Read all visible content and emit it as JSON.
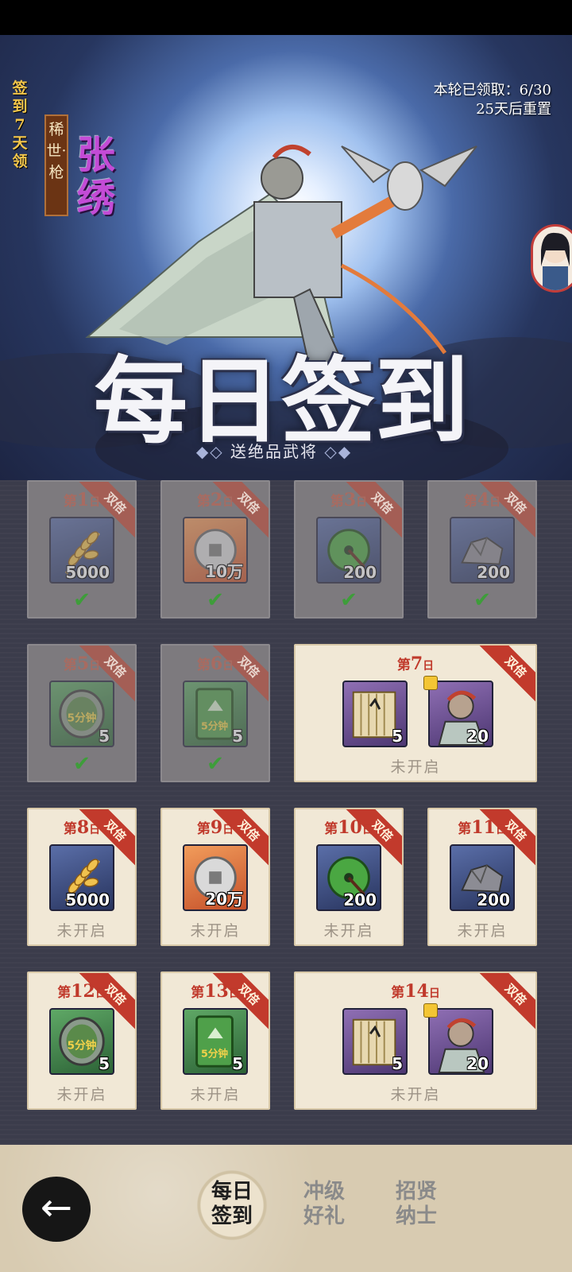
{
  "banner": {
    "side_label": "签到7天领",
    "rarity": "稀世·枪",
    "hero_name": "张绣",
    "progress_line1": "本轮已领取：6/30",
    "progress_line2": "25天后重置",
    "title": "每日签到",
    "subtitle": "送绝品武将"
  },
  "days": [
    {
      "prefix": "第",
      "num": "1",
      "suffix": "日",
      "badge": "双倍",
      "items": [
        {
          "icon": "wheat-icon",
          "qty": "5000"
        }
      ],
      "status": "claimed"
    },
    {
      "prefix": "第",
      "num": "2",
      "suffix": "日",
      "badge": "双倍",
      "items": [
        {
          "icon": "coin-icon",
          "qty": "10万"
        }
      ],
      "status": "claimed"
    },
    {
      "prefix": "第",
      "num": "3",
      "suffix": "日",
      "badge": "双倍",
      "items": [
        {
          "icon": "jade-disc-icon",
          "qty": "200"
        }
      ],
      "status": "claimed"
    },
    {
      "prefix": "第",
      "num": "4",
      "suffix": "日",
      "badge": "双倍",
      "items": [
        {
          "icon": "ore-icon",
          "qty": "200"
        }
      ],
      "status": "claimed"
    },
    {
      "prefix": "第",
      "num": "5",
      "suffix": "日",
      "badge": "双倍",
      "items": [
        {
          "icon": "speedup-token-icon",
          "qty": "5",
          "label": "5分钟"
        }
      ],
      "status": "claimed"
    },
    {
      "prefix": "第",
      "num": "6",
      "suffix": "日",
      "badge": "双倍",
      "items": [
        {
          "icon": "speedup-card-icon",
          "qty": "5",
          "label": "5分钟"
        }
      ],
      "status": "claimed"
    },
    {
      "prefix": "第",
      "num": "7",
      "suffix": "日",
      "badge": "双倍",
      "items": [
        {
          "icon": "scroll-icon",
          "qty": "5"
        },
        {
          "icon": "hero-shard-icon",
          "qty": "20"
        }
      ],
      "status": "未开启"
    },
    {
      "prefix": "第",
      "num": "8",
      "suffix": "日",
      "badge": "双倍",
      "items": [
        {
          "icon": "wheat-icon",
          "qty": "5000"
        }
      ],
      "status": "未开启"
    },
    {
      "prefix": "第",
      "num": "9",
      "suffix": "日",
      "badge": "双倍",
      "items": [
        {
          "icon": "coin-icon",
          "qty": "20万"
        }
      ],
      "status": "未开启"
    },
    {
      "prefix": "第",
      "num": "10",
      "suffix": "日",
      "badge": "双倍",
      "items": [
        {
          "icon": "jade-disc-icon",
          "qty": "200"
        }
      ],
      "status": "未开启"
    },
    {
      "prefix": "第",
      "num": "11",
      "suffix": "日",
      "badge": "双倍",
      "items": [
        {
          "icon": "ore-icon",
          "qty": "200"
        }
      ],
      "status": "未开启"
    },
    {
      "prefix": "第",
      "num": "12",
      "suffix": "日",
      "badge": "双倍",
      "items": [
        {
          "icon": "speedup-token-icon",
          "qty": "5",
          "label": "5分钟"
        }
      ],
      "status": "未开启"
    },
    {
      "prefix": "第",
      "num": "13",
      "suffix": "日",
      "badge": "双倍",
      "items": [
        {
          "icon": "speedup-card-icon",
          "qty": "5",
          "label": "5分钟"
        }
      ],
      "status": "未开启"
    },
    {
      "prefix": "第",
      "num": "14",
      "suffix": "日",
      "badge": "双倍",
      "items": [
        {
          "icon": "scroll-icon",
          "qty": "5"
        },
        {
          "icon": "hero-shard-icon",
          "qty": "20"
        }
      ],
      "status": "未开启"
    }
  ],
  "nav": {
    "back_icon": "back-arrow-icon",
    "tabs": [
      {
        "line1": "每日",
        "line2": "签到",
        "active": true
      },
      {
        "line1": "冲级",
        "line2": "好礼",
        "active": false
      },
      {
        "line1": "招贤",
        "line2": "纳士",
        "active": false
      }
    ]
  },
  "colors": {
    "accent_red": "#c23a2c",
    "claimed_check": "#3fbf3a",
    "hero_name": "#c34bd6",
    "side_label": "#f3c64b"
  }
}
